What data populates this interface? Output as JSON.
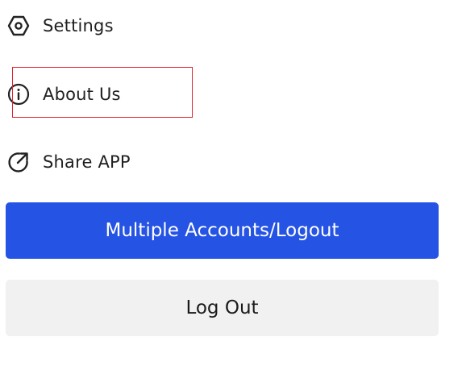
{
  "menu": {
    "items": [
      {
        "label": "Settings",
        "icon": "settings-hexagon-icon"
      },
      {
        "label": "About Us",
        "icon": "info-circle-icon"
      },
      {
        "label": "Share APP",
        "icon": "share-arrow-icon"
      }
    ]
  },
  "buttons": {
    "multiple_accounts_label": "Multiple Accounts/Logout",
    "logout_label": "Log Out"
  },
  "colors": {
    "primary_button": "#2553e3",
    "secondary_button": "#f1f1f1",
    "highlight_border": "#e0242f",
    "text": "#1f1f1f"
  }
}
